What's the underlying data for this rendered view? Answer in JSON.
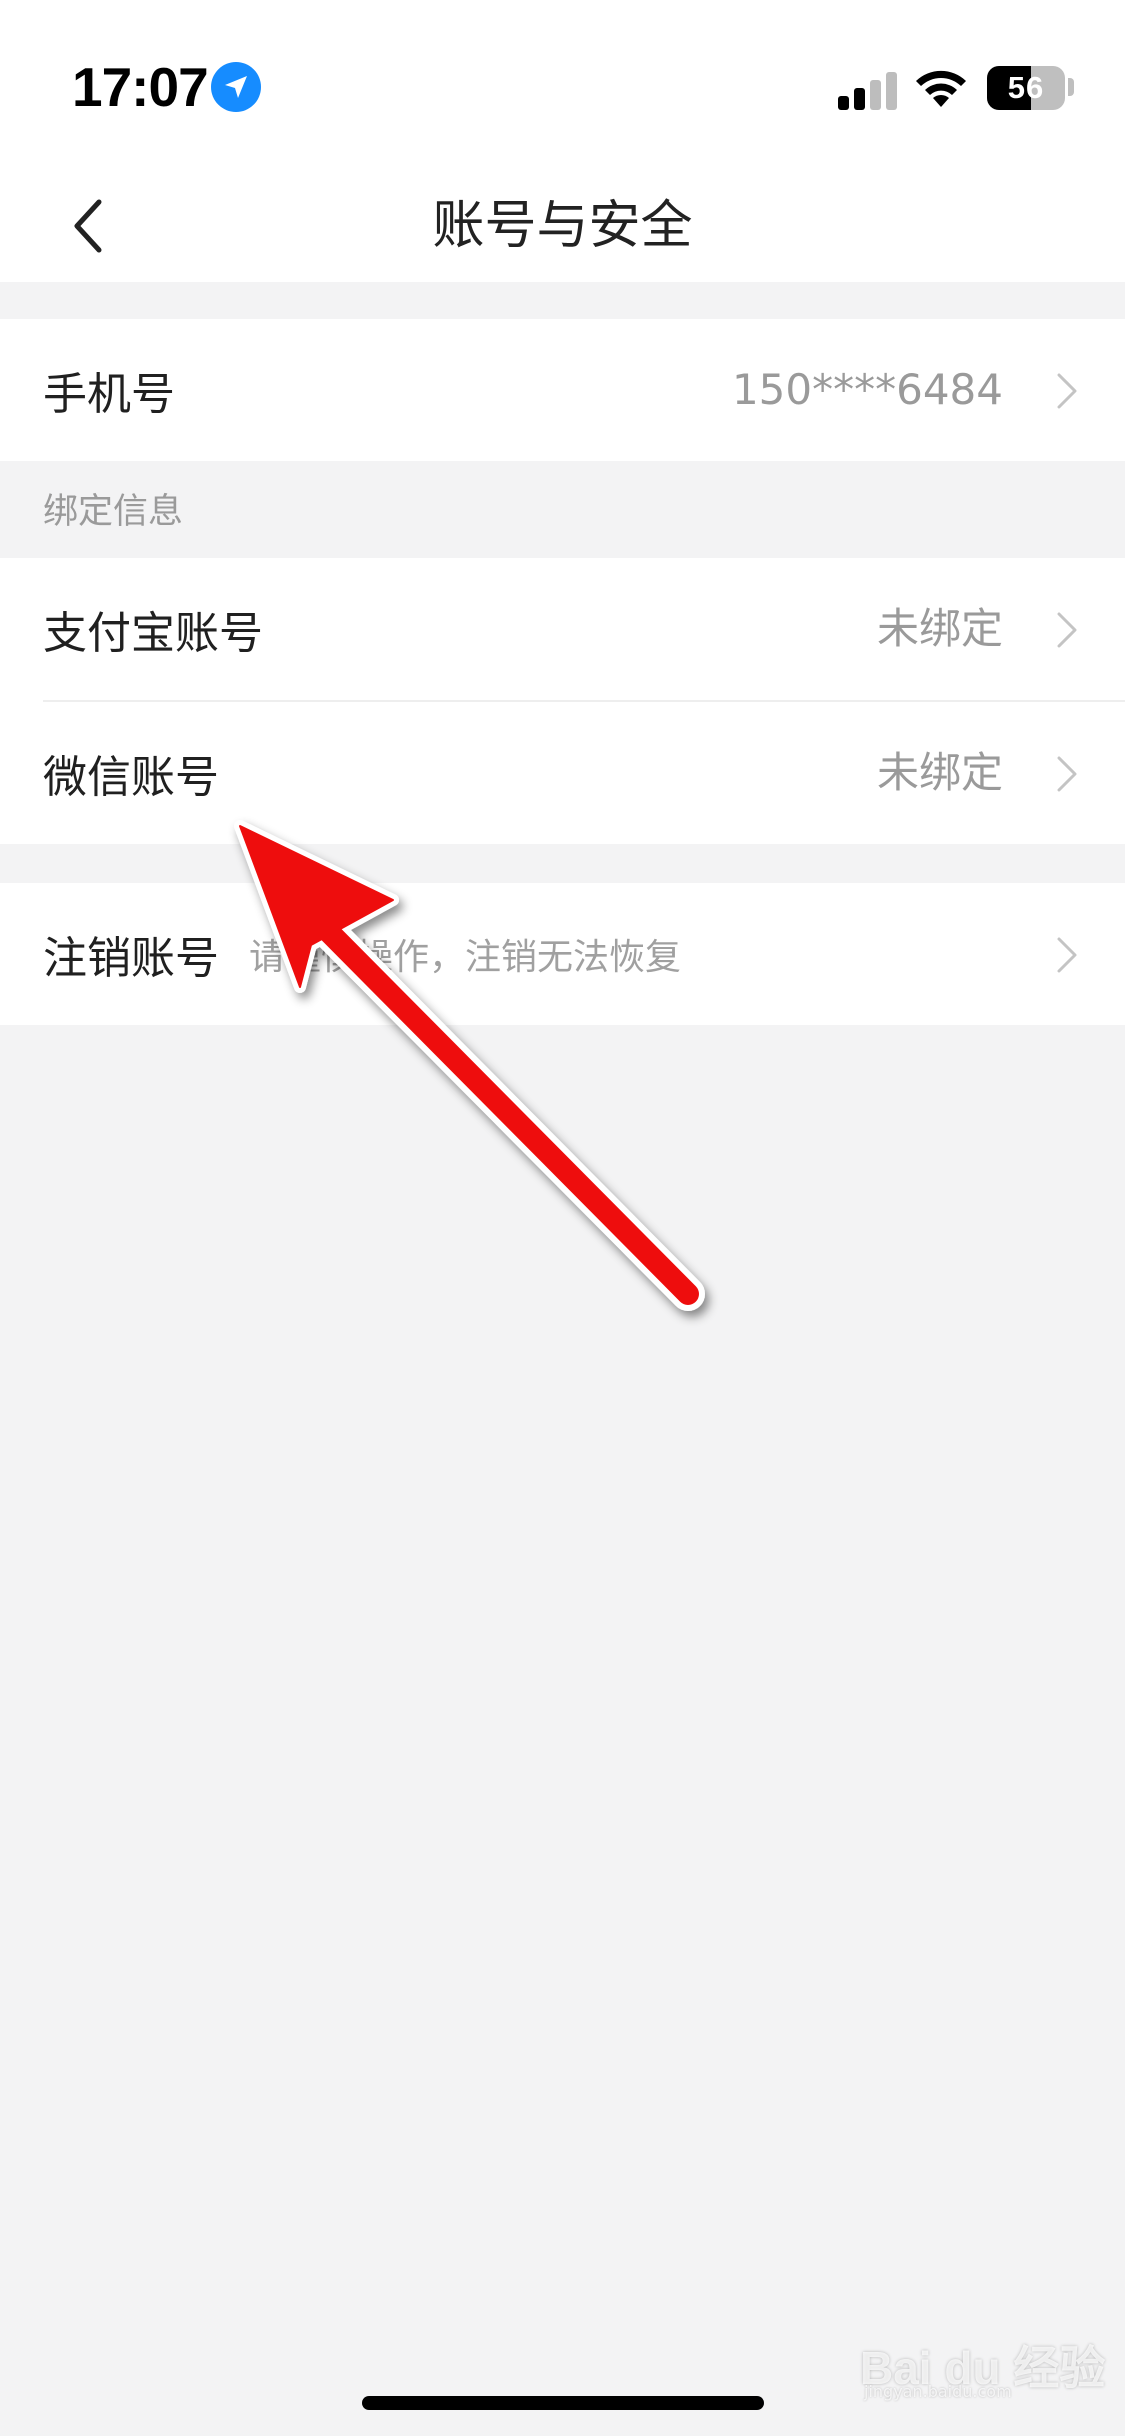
{
  "status_bar": {
    "time": "17:07",
    "battery_level": "56",
    "battery_fraction": 0.56
  },
  "nav": {
    "title": "账号与安全"
  },
  "phone_row": {
    "label": "手机号",
    "value": "150****6484"
  },
  "binding_section": {
    "header": "绑定信息",
    "items": [
      {
        "label": "支付宝账号",
        "value": "未绑定"
      },
      {
        "label": "微信账号",
        "value": "未绑定"
      }
    ]
  },
  "cancel_row": {
    "label": "注销账号",
    "hint": "请谨慎操作，注销无法恢复"
  },
  "annotation": {
    "arrow_color": "#ee1111"
  },
  "watermark": {
    "text": "Bai du 经验",
    "sub": "jingyan.baidu.com"
  },
  "colors": {
    "background": "#f3f3f4",
    "accent": "#168cff"
  }
}
